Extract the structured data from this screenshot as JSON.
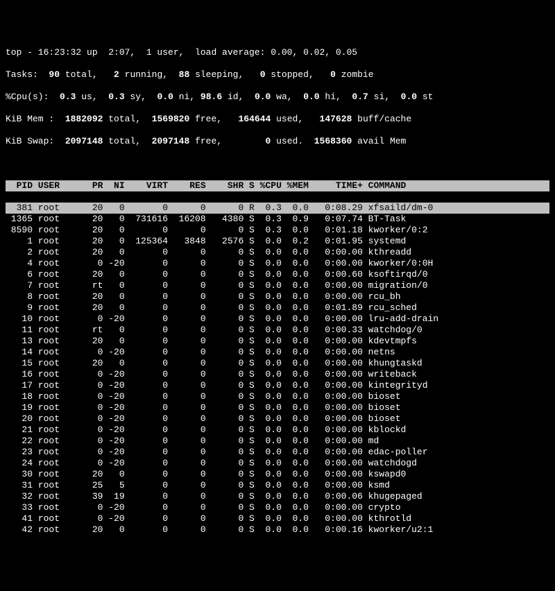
{
  "summary": {
    "line1": "top - 16:23:32 up  2:07,  1 user,  load average: 0.00, 0.02, 0.05",
    "tasks": {
      "label": "Tasks:",
      "total": "90",
      "running": "2",
      "sleeping": "88",
      "stopped": "0",
      "zombie": "0"
    },
    "cpu": {
      "label": "%Cpu(s):",
      "us": "0.3",
      "sy": "0.3",
      "ni": "0.0",
      "id": "98.6",
      "wa": "0.0",
      "hi": "0.0",
      "si": "0.7",
      "st": "0.0"
    },
    "mem": {
      "label": "KiB Mem :",
      "total": "1882092",
      "free": "1569820",
      "used": "164644",
      "buff": "147628"
    },
    "swap": {
      "label": "KiB Swap:",
      "total": "2097148",
      "free": "2097148",
      "used": "0",
      "avail": "1568360"
    }
  },
  "columns": "  PID USER      PR  NI    VIRT    RES    SHR S %CPU %MEM     TIME+ COMMAND          ",
  "rows": [
    {
      "pid": "381",
      "user": "root",
      "pr": "20",
      "ni": "0",
      "virt": "0",
      "res": "0",
      "shr": "0",
      "s": "R",
      "cpu": "0.3",
      "mem": "0.0",
      "time": "0:08.29",
      "cmd": "xfsaild/dm-0",
      "hl": true
    },
    {
      "pid": "1365",
      "user": "root",
      "pr": "20",
      "ni": "0",
      "virt": "731616",
      "res": "16208",
      "shr": "4380",
      "s": "S",
      "cpu": "0.3",
      "mem": "0.9",
      "time": "0:07.74",
      "cmd": "BT-Task"
    },
    {
      "pid": "8590",
      "user": "root",
      "pr": "20",
      "ni": "0",
      "virt": "0",
      "res": "0",
      "shr": "0",
      "s": "S",
      "cpu": "0.3",
      "mem": "0.0",
      "time": "0:01.18",
      "cmd": "kworker/0:2"
    },
    {
      "pid": "1",
      "user": "root",
      "pr": "20",
      "ni": "0",
      "virt": "125364",
      "res": "3848",
      "shr": "2576",
      "s": "S",
      "cpu": "0.0",
      "mem": "0.2",
      "time": "0:01.95",
      "cmd": "systemd"
    },
    {
      "pid": "2",
      "user": "root",
      "pr": "20",
      "ni": "0",
      "virt": "0",
      "res": "0",
      "shr": "0",
      "s": "S",
      "cpu": "0.0",
      "mem": "0.0",
      "time": "0:00.00",
      "cmd": "kthreadd"
    },
    {
      "pid": "4",
      "user": "root",
      "pr": "0",
      "ni": "-20",
      "virt": "0",
      "res": "0",
      "shr": "0",
      "s": "S",
      "cpu": "0.0",
      "mem": "0.0",
      "time": "0:00.00",
      "cmd": "kworker/0:0H"
    },
    {
      "pid": "6",
      "user": "root",
      "pr": "20",
      "ni": "0",
      "virt": "0",
      "res": "0",
      "shr": "0",
      "s": "S",
      "cpu": "0.0",
      "mem": "0.0",
      "time": "0:00.60",
      "cmd": "ksoftirqd/0"
    },
    {
      "pid": "7",
      "user": "root",
      "pr": "rt",
      "ni": "0",
      "virt": "0",
      "res": "0",
      "shr": "0",
      "s": "S",
      "cpu": "0.0",
      "mem": "0.0",
      "time": "0:00.00",
      "cmd": "migration/0"
    },
    {
      "pid": "8",
      "user": "root",
      "pr": "20",
      "ni": "0",
      "virt": "0",
      "res": "0",
      "shr": "0",
      "s": "S",
      "cpu": "0.0",
      "mem": "0.0",
      "time": "0:00.00",
      "cmd": "rcu_bh"
    },
    {
      "pid": "9",
      "user": "root",
      "pr": "20",
      "ni": "0",
      "virt": "0",
      "res": "0",
      "shr": "0",
      "s": "S",
      "cpu": "0.0",
      "mem": "0.0",
      "time": "0:01.89",
      "cmd": "rcu_sched"
    },
    {
      "pid": "10",
      "user": "root",
      "pr": "0",
      "ni": "-20",
      "virt": "0",
      "res": "0",
      "shr": "0",
      "s": "S",
      "cpu": "0.0",
      "mem": "0.0",
      "time": "0:00.00",
      "cmd": "lru-add-drain"
    },
    {
      "pid": "11",
      "user": "root",
      "pr": "rt",
      "ni": "0",
      "virt": "0",
      "res": "0",
      "shr": "0",
      "s": "S",
      "cpu": "0.0",
      "mem": "0.0",
      "time": "0:00.33",
      "cmd": "watchdog/0"
    },
    {
      "pid": "13",
      "user": "root",
      "pr": "20",
      "ni": "0",
      "virt": "0",
      "res": "0",
      "shr": "0",
      "s": "S",
      "cpu": "0.0",
      "mem": "0.0",
      "time": "0:00.00",
      "cmd": "kdevtmpfs"
    },
    {
      "pid": "14",
      "user": "root",
      "pr": "0",
      "ni": "-20",
      "virt": "0",
      "res": "0",
      "shr": "0",
      "s": "S",
      "cpu": "0.0",
      "mem": "0.0",
      "time": "0:00.00",
      "cmd": "netns"
    },
    {
      "pid": "15",
      "user": "root",
      "pr": "20",
      "ni": "0",
      "virt": "0",
      "res": "0",
      "shr": "0",
      "s": "S",
      "cpu": "0.0",
      "mem": "0.0",
      "time": "0:00.00",
      "cmd": "khungtaskd"
    },
    {
      "pid": "16",
      "user": "root",
      "pr": "0",
      "ni": "-20",
      "virt": "0",
      "res": "0",
      "shr": "0",
      "s": "S",
      "cpu": "0.0",
      "mem": "0.0",
      "time": "0:00.00",
      "cmd": "writeback"
    },
    {
      "pid": "17",
      "user": "root",
      "pr": "0",
      "ni": "-20",
      "virt": "0",
      "res": "0",
      "shr": "0",
      "s": "S",
      "cpu": "0.0",
      "mem": "0.0",
      "time": "0:00.00",
      "cmd": "kintegrityd"
    },
    {
      "pid": "18",
      "user": "root",
      "pr": "0",
      "ni": "-20",
      "virt": "0",
      "res": "0",
      "shr": "0",
      "s": "S",
      "cpu": "0.0",
      "mem": "0.0",
      "time": "0:00.00",
      "cmd": "bioset"
    },
    {
      "pid": "19",
      "user": "root",
      "pr": "0",
      "ni": "-20",
      "virt": "0",
      "res": "0",
      "shr": "0",
      "s": "S",
      "cpu": "0.0",
      "mem": "0.0",
      "time": "0:00.00",
      "cmd": "bioset"
    },
    {
      "pid": "20",
      "user": "root",
      "pr": "0",
      "ni": "-20",
      "virt": "0",
      "res": "0",
      "shr": "0",
      "s": "S",
      "cpu": "0.0",
      "mem": "0.0",
      "time": "0:00.00",
      "cmd": "bioset"
    },
    {
      "pid": "21",
      "user": "root",
      "pr": "0",
      "ni": "-20",
      "virt": "0",
      "res": "0",
      "shr": "0",
      "s": "S",
      "cpu": "0.0",
      "mem": "0.0",
      "time": "0:00.00",
      "cmd": "kblockd"
    },
    {
      "pid": "22",
      "user": "root",
      "pr": "0",
      "ni": "-20",
      "virt": "0",
      "res": "0",
      "shr": "0",
      "s": "S",
      "cpu": "0.0",
      "mem": "0.0",
      "time": "0:00.00",
      "cmd": "md"
    },
    {
      "pid": "23",
      "user": "root",
      "pr": "0",
      "ni": "-20",
      "virt": "0",
      "res": "0",
      "shr": "0",
      "s": "S",
      "cpu": "0.0",
      "mem": "0.0",
      "time": "0:00.00",
      "cmd": "edac-poller"
    },
    {
      "pid": "24",
      "user": "root",
      "pr": "0",
      "ni": "-20",
      "virt": "0",
      "res": "0",
      "shr": "0",
      "s": "S",
      "cpu": "0.0",
      "mem": "0.0",
      "time": "0:00.00",
      "cmd": "watchdogd"
    },
    {
      "pid": "30",
      "user": "root",
      "pr": "20",
      "ni": "0",
      "virt": "0",
      "res": "0",
      "shr": "0",
      "s": "S",
      "cpu": "0.0",
      "mem": "0.0",
      "time": "0:00.00",
      "cmd": "kswapd0"
    },
    {
      "pid": "31",
      "user": "root",
      "pr": "25",
      "ni": "5",
      "virt": "0",
      "res": "0",
      "shr": "0",
      "s": "S",
      "cpu": "0.0",
      "mem": "0.0",
      "time": "0:00.00",
      "cmd": "ksmd"
    },
    {
      "pid": "32",
      "user": "root",
      "pr": "39",
      "ni": "19",
      "virt": "0",
      "res": "0",
      "shr": "0",
      "s": "S",
      "cpu": "0.0",
      "mem": "0.0",
      "time": "0:00.06",
      "cmd": "khugepaged"
    },
    {
      "pid": "33",
      "user": "root",
      "pr": "0",
      "ni": "-20",
      "virt": "0",
      "res": "0",
      "shr": "0",
      "s": "S",
      "cpu": "0.0",
      "mem": "0.0",
      "time": "0:00.00",
      "cmd": "crypto"
    },
    {
      "pid": "41",
      "user": "root",
      "pr": "0",
      "ni": "-20",
      "virt": "0",
      "res": "0",
      "shr": "0",
      "s": "S",
      "cpu": "0.0",
      "mem": "0.0",
      "time": "0:00.00",
      "cmd": "kthrotld"
    },
    {
      "pid": "42",
      "user": "root",
      "pr": "20",
      "ni": "0",
      "virt": "0",
      "res": "0",
      "shr": "0",
      "s": "S",
      "cpu": "0.0",
      "mem": "0.0",
      "time": "0:00.16",
      "cmd": "kworker/u2:1"
    }
  ]
}
